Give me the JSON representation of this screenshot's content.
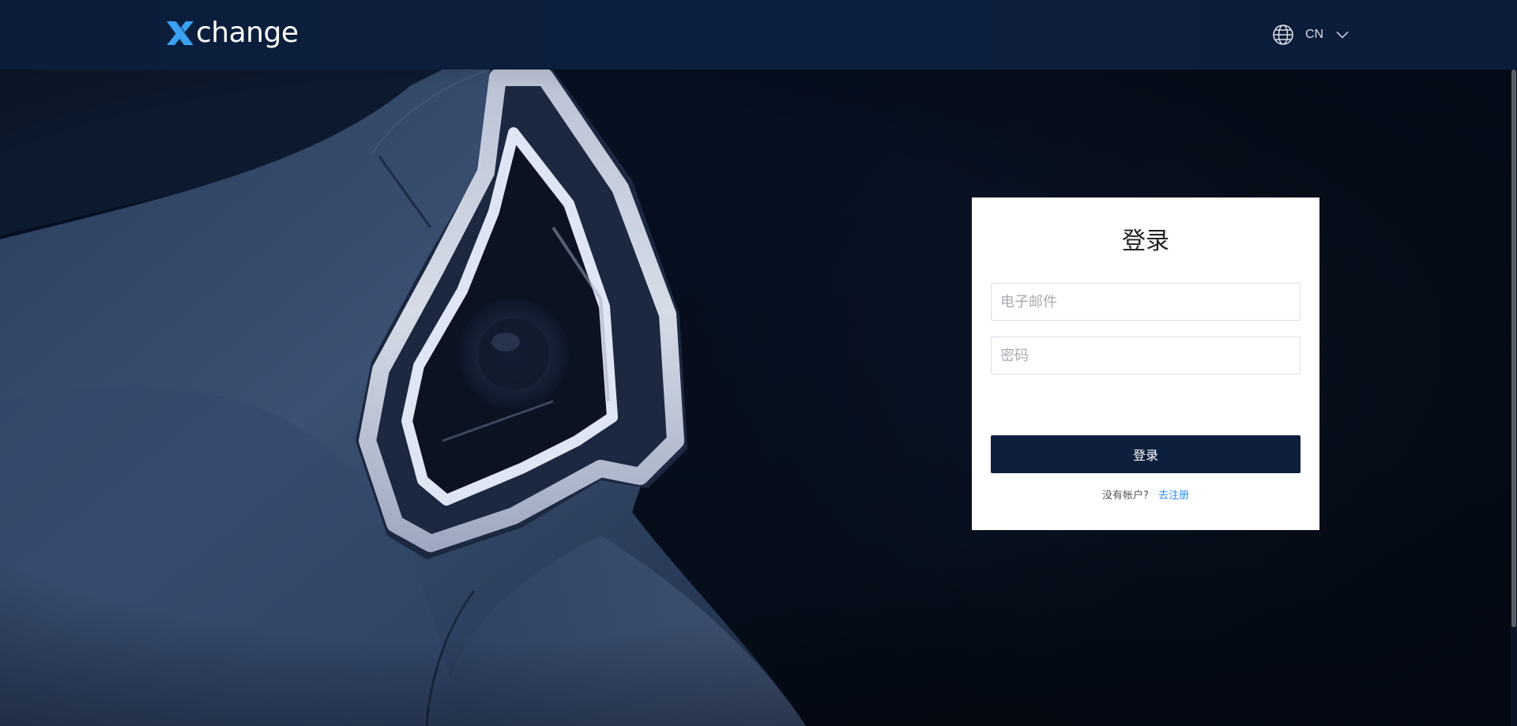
{
  "header": {
    "brand": "change",
    "language": {
      "label": "CN"
    }
  },
  "login": {
    "title": "登录",
    "email": {
      "placeholder": "电子邮件",
      "value": ""
    },
    "password": {
      "placeholder": "密码",
      "value": ""
    },
    "submit_label": "登录",
    "no_account_text": "没有帐户?",
    "register_link": "去注册"
  },
  "icons": {
    "logo_mark": "x-logo-icon",
    "language": "globe-icon",
    "dropdown": "chevron-down-icon"
  },
  "colors": {
    "header_bg": "#0b1d3a",
    "accent_blue": "#2d8cf0",
    "logo_blue": "#3aa0f2",
    "button_bg": "#0e1f3d",
    "card_bg": "#ffffff"
  }
}
